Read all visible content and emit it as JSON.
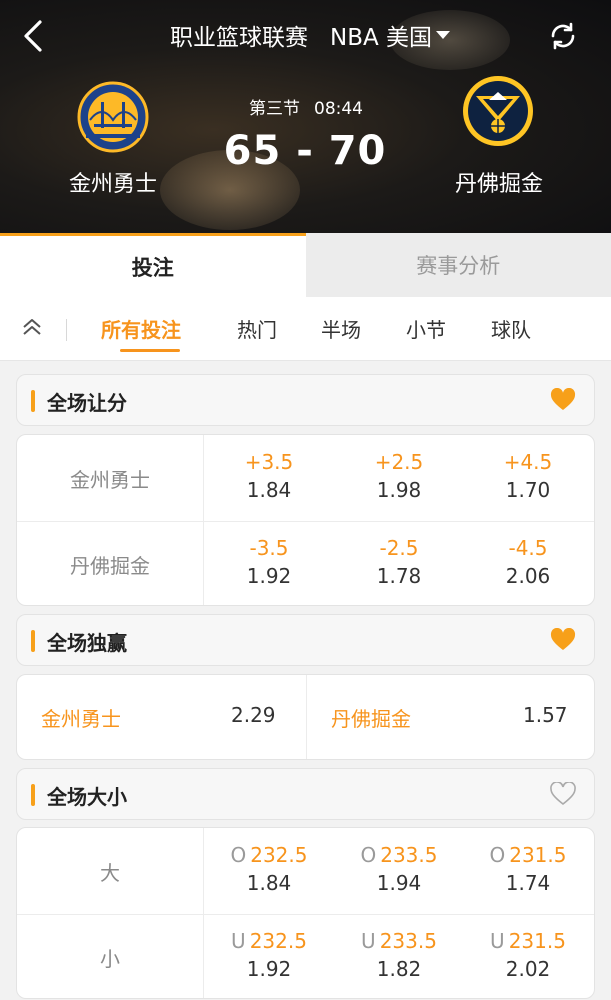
{
  "header": {
    "title_league": "职业篮球联赛",
    "title_region": "NBA 美国",
    "period": "第三节",
    "clock": "08:44",
    "score": "65 - 70",
    "home_team": "金州勇士",
    "away_team": "丹佛掘金"
  },
  "main_tabs": [
    {
      "label": "投注"
    },
    {
      "label": "赛事分析"
    }
  ],
  "sub_tabs": [
    {
      "label": "所有投注"
    },
    {
      "label": "热门"
    },
    {
      "label": "半场"
    },
    {
      "label": "小节"
    },
    {
      "label": "球队"
    }
  ],
  "handicap": {
    "title": "全场让分",
    "rows": [
      {
        "team": "金州勇士",
        "cells": [
          {
            "line": "+3.5",
            "odd": "1.84"
          },
          {
            "line": "+2.5",
            "odd": "1.98"
          },
          {
            "line": "+4.5",
            "odd": "1.70"
          }
        ]
      },
      {
        "team": "丹佛掘金",
        "cells": [
          {
            "line": "-3.5",
            "odd": "1.92"
          },
          {
            "line": "-2.5",
            "odd": "1.78"
          },
          {
            "line": "-4.5",
            "odd": "2.06"
          }
        ]
      }
    ]
  },
  "moneyline": {
    "title": "全场独赢",
    "home": {
      "team": "金州勇士",
      "odd": "2.29"
    },
    "away": {
      "team": "丹佛掘金",
      "odd": "1.57"
    }
  },
  "totals": {
    "title": "全场大小",
    "rows": [
      {
        "label": "大",
        "cells": [
          {
            "prefix": "O",
            "line": "232.5",
            "odd": "1.84"
          },
          {
            "prefix": "O",
            "line": "233.5",
            "odd": "1.94"
          },
          {
            "prefix": "O",
            "line": "231.5",
            "odd": "1.74"
          }
        ]
      },
      {
        "label": "小",
        "cells": [
          {
            "prefix": "U",
            "line": "232.5",
            "odd": "1.92"
          },
          {
            "prefix": "U",
            "line": "233.5",
            "odd": "1.82"
          },
          {
            "prefix": "U",
            "line": "231.5",
            "odd": "2.02"
          }
        ]
      }
    ]
  },
  "favorites": {
    "handicap": true,
    "moneyline": true,
    "totals": false
  },
  "colors": {
    "accent": "#f7941d",
    "header_bg": "#1c1a18"
  },
  "icons": {
    "back": "back-arrow-icon",
    "refresh": "refresh-icon",
    "collapse": "double-chevron-up-icon",
    "favorite": "heart-icon"
  }
}
